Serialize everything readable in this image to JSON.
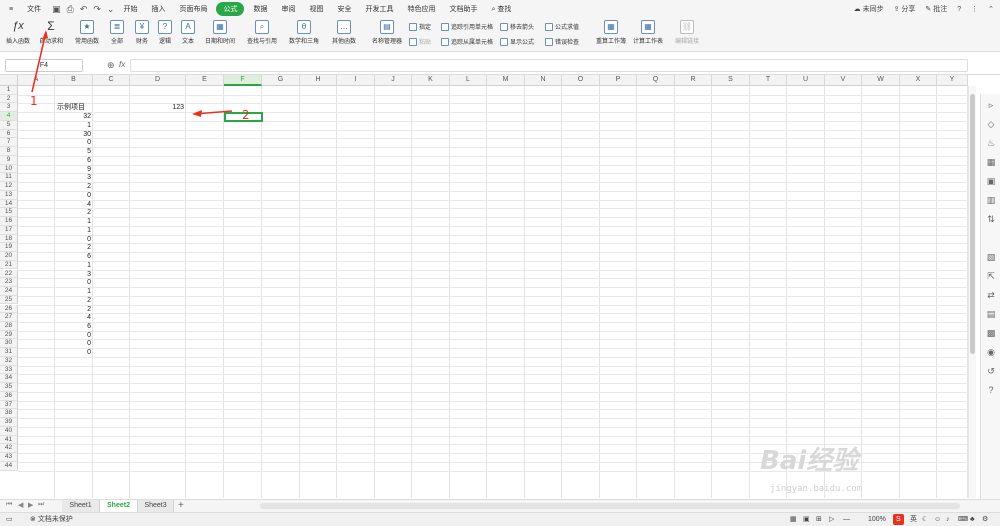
{
  "menubar": {
    "file": "文件",
    "tabs": [
      "开始",
      "插入",
      "页面布局",
      "公式",
      "数据",
      "审阅",
      "视图",
      "安全",
      "开发工具",
      "特色应用",
      "文档助手"
    ],
    "active_tab": "公式",
    "search": "查找",
    "sync": "未同步",
    "share": "分享",
    "annotate": "批注",
    "help": "?"
  },
  "ribbon": {
    "insert_func": "插入函数",
    "autosum": "自动求和",
    "common": "常用函数",
    "all": "全部",
    "finance": "财务",
    "logic": "逻辑",
    "text": "文本",
    "datetime": "日期和时间",
    "lookup": "查找与引用",
    "math": "数学和三角",
    "other": "其他函数",
    "name_mgr": "名称管理器",
    "paste": "指定",
    "paste2": "粘贴",
    "trace_prec": "追踪引用单元格",
    "trace_dep": "追踪从属单元格",
    "remove_arrows": "移去箭头",
    "show_formula": "显示公式",
    "eval": "公式求值",
    "err_check": "错误检查",
    "recalc_book": "重算工作簿",
    "calc_sheet": "计算工作表",
    "edit_links": "编辑链接"
  },
  "formula_bar": {
    "name_box": "F4",
    "fx": "fx"
  },
  "columns": [
    "A",
    "B",
    "C",
    "D",
    "E",
    "F",
    "G",
    "H",
    "I",
    "J",
    "K",
    "L",
    "M",
    "N",
    "O",
    "P",
    "Q",
    "R",
    "S",
    "T",
    "U",
    "V",
    "W",
    "X",
    "Y"
  ],
  "selected_column": "F",
  "selected_row": 4,
  "rows_count": 44,
  "cells": {
    "b3": "示例项目",
    "d3": "123",
    "b_values": [
      "32",
      "1",
      "30",
      "0",
      "5",
      "6",
      "9",
      "3",
      "2",
      "0",
      "4",
      "2",
      "1",
      "1",
      "0",
      "2",
      "6",
      "1",
      "3",
      "0",
      "1",
      "2",
      "2",
      "4",
      "6",
      "0",
      "0",
      "0"
    ]
  },
  "annotations": {
    "one": "1",
    "two": "2"
  },
  "sheets": [
    "Sheet1",
    "Sheet2",
    "Sheet3"
  ],
  "active_sheet": "Sheet2",
  "add_sheet": "+",
  "status": {
    "protect": "文档未保护",
    "zoom": "100%",
    "ime": "英"
  },
  "watermark": {
    "brand": "Bai经验",
    "url": "jingyan.baidu.com"
  },
  "colors": {
    "accent": "#2aa646",
    "arrow": "#e8321f"
  }
}
